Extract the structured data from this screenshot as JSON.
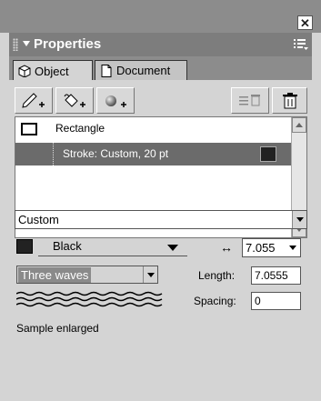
{
  "panel": {
    "title": "Properties",
    "tabs": [
      {
        "label": "Object",
        "active": true
      },
      {
        "label": "Document",
        "active": false
      }
    ]
  },
  "toolbar": {
    "buttons": [
      "add-stroke",
      "add-fill",
      "add-effect",
      "delete-selected",
      "trash"
    ]
  },
  "object_list": {
    "items": [
      {
        "label": "Rectangle",
        "icon": "rectangle-icon",
        "selected": false
      },
      {
        "label": "Stroke: Custom, 20 pt",
        "icon": "color-swatch",
        "swatch": "#222222",
        "selected": true
      }
    ]
  },
  "stroke": {
    "category": "Custom",
    "color_name": "Black",
    "color_hex": "#222222",
    "width_value": "7.055",
    "texture": "Three waves",
    "length_label": "Length:",
    "length_value": "7.0555",
    "spacing_label": "Spacing:",
    "spacing_value": "0",
    "sample_label": "Sample enlarged"
  },
  "colors": {
    "selection_bg": "#6b6b6b",
    "header_bg": "#7d7d7d",
    "panel_bg": "#d4d4d4"
  }
}
